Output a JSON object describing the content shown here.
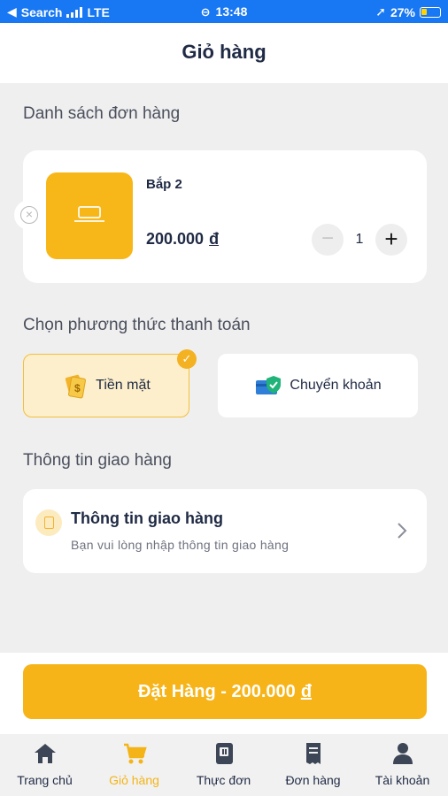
{
  "status_bar": {
    "carrier": "Search",
    "network": "LTE",
    "time": "13:48",
    "battery": "27%"
  },
  "header": {
    "title": "Giỏ hàng"
  },
  "order_list": {
    "title": "Danh sách đơn hàng",
    "items": [
      {
        "name": "Bắp 2",
        "price": "200.000",
        "currency": "đ",
        "quantity": "1",
        "minus": "−",
        "plus": "+"
      }
    ]
  },
  "payment": {
    "title": "Chọn phương thức thanh toán",
    "options": [
      {
        "label": "Tiền mặt",
        "selected": true,
        "icon": "cash-icon"
      },
      {
        "label": "Chuyển khoản",
        "selected": false,
        "icon": "bank-transfer-icon"
      }
    ],
    "check": "✓"
  },
  "delivery": {
    "title": "Thông tin giao hàng",
    "card_title": "Thông tin giao hàng",
    "card_subtitle": "Bạn vui lòng nhập thông tin giao hàng"
  },
  "order_button": {
    "label": "Đặt Hàng - 200.000",
    "currency": "đ"
  },
  "tabs": [
    {
      "label": "Trang chủ",
      "icon": "home-icon",
      "active": false
    },
    {
      "label": "Giỏ hàng",
      "icon": "cart-icon",
      "active": true
    },
    {
      "label": "Thực đơn",
      "icon": "menu-book-icon",
      "active": false
    },
    {
      "label": "Đơn hàng",
      "icon": "receipt-icon",
      "active": false
    },
    {
      "label": "Tài khoản",
      "icon": "account-icon",
      "active": false
    }
  ],
  "colors": {
    "accent": "#f7b418",
    "status_bar": "#1877f2",
    "text": "#1f2a44",
    "background": "#efefef"
  }
}
